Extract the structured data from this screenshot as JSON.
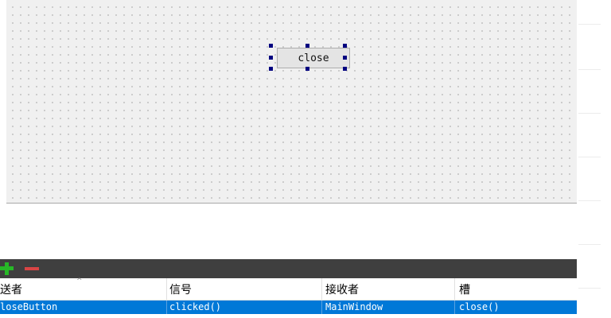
{
  "form": {
    "close_button_label": "close"
  },
  "signal_slot_editor": {
    "toolbar": {
      "add_icon": "plus-icon",
      "remove_icon": "minus-icon",
      "add_color": "#27b827",
      "remove_color": "#d94545"
    },
    "columns": [
      "发送者",
      "信号",
      "接收者",
      "槽"
    ],
    "column_header_visible_text": [
      "送者",
      "信号",
      "接收者",
      "槽"
    ],
    "rows": [
      {
        "sender": "closeButton",
        "sender_visible": "loseButton",
        "signal": "clicked()",
        "receiver": "MainWindow",
        "slot": "close()",
        "selected": true
      }
    ],
    "selection_color": "#0078d7"
  }
}
